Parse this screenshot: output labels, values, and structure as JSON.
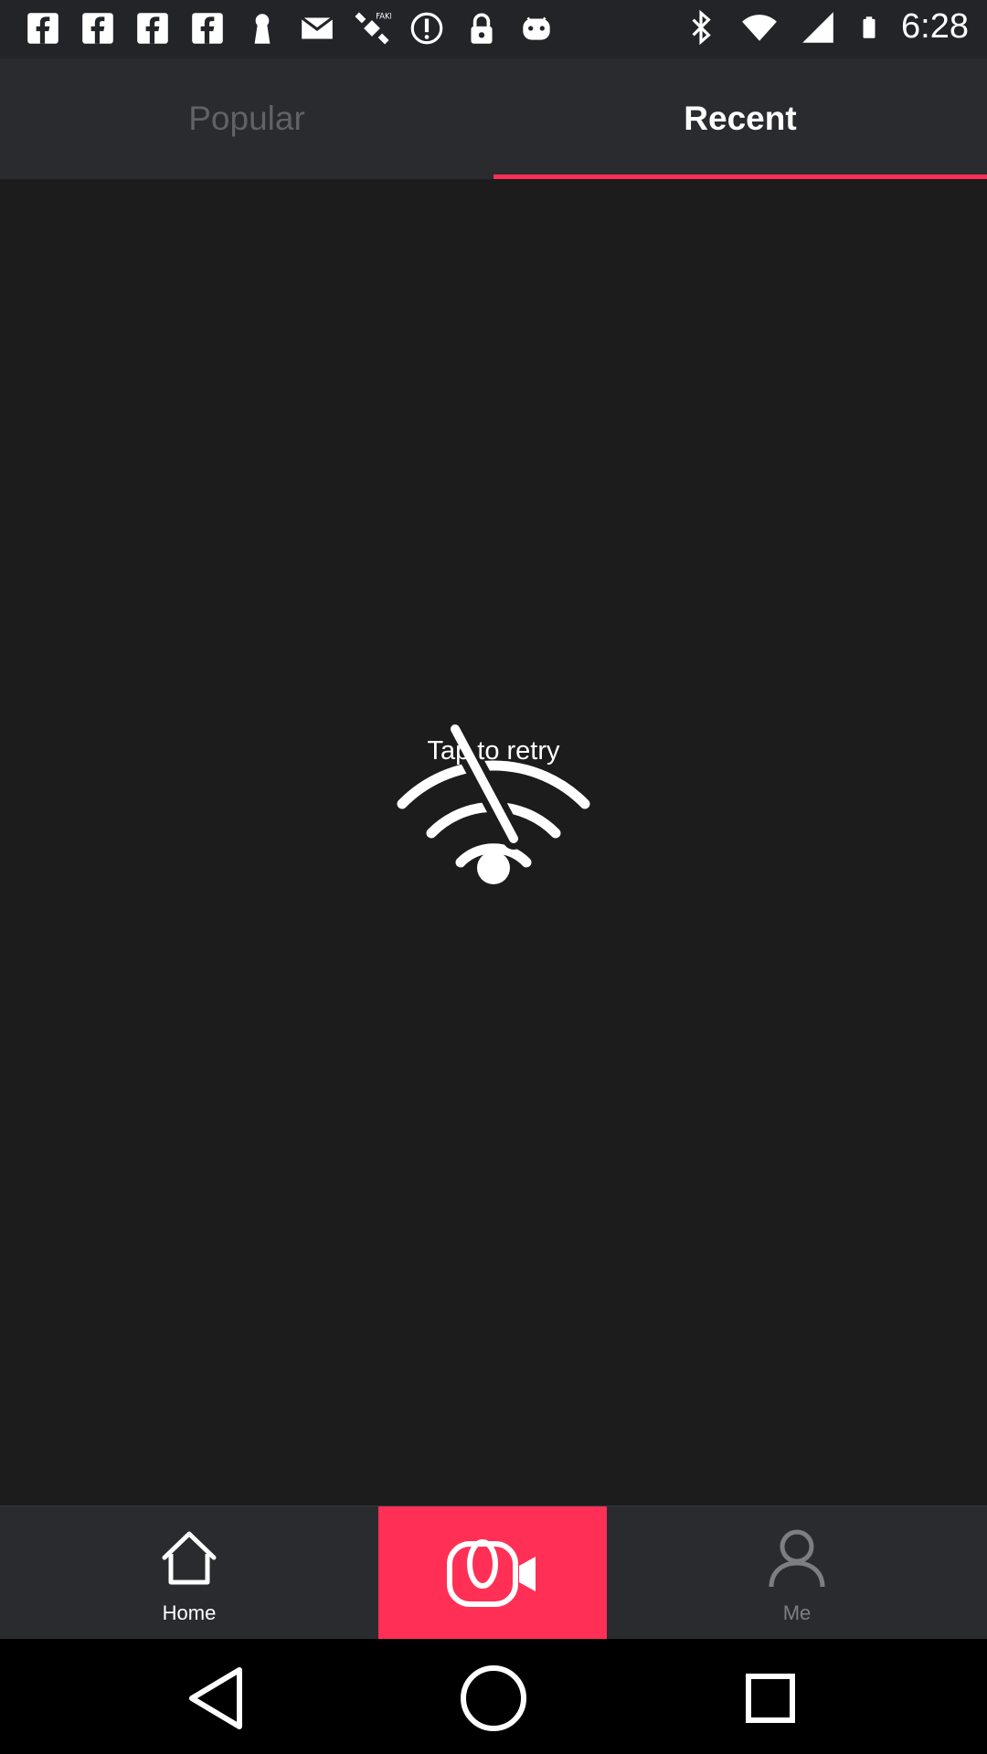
{
  "status_bar": {
    "time": "6:28",
    "left_icons": [
      "facebook-icon",
      "facebook-icon",
      "facebook-icon",
      "facebook-icon",
      "keyhole-icon",
      "mail-icon",
      "satellite-icon",
      "alert-circle-icon",
      "lock-icon",
      "android-icon"
    ],
    "right_icons": [
      "bluetooth-icon",
      "wifi-icon",
      "signal-icon",
      "battery-icon"
    ]
  },
  "tabs": [
    {
      "label": "Popular",
      "selected": false
    },
    {
      "label": "Recent",
      "selected": true
    }
  ],
  "main": {
    "retry_text": "Tap to retry",
    "icon": "wifi-off-icon"
  },
  "bottom_nav": {
    "home_label": "Home",
    "record_icon": "video-record-icon",
    "me_label": "Me"
  },
  "colors": {
    "accent": "#ff2f55",
    "background": "#1c1c1c",
    "bar": "#2a2b2f"
  }
}
